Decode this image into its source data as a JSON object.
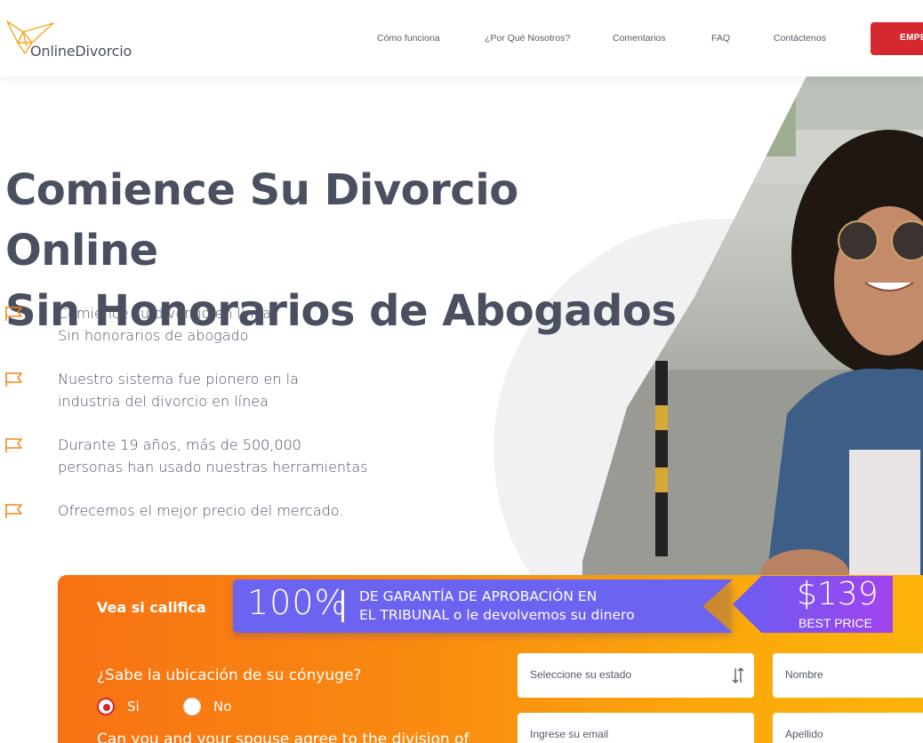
{
  "brand": {
    "name": "OnlineDivorcio"
  },
  "nav": {
    "items": [
      "Cómo funciona",
      "¿Por Qué Nosotros?",
      "Comentarios",
      "FAQ",
      "Contáctenos"
    ],
    "cta_label": "EMPE"
  },
  "hero": {
    "title_line1": "Comience Su Divorcio Online",
    "title_line2": "Sin Honorarios de Abogados",
    "features": [
      "Comience su divorcio en línea\nSin honorarios de abogado",
      "Nuestro sistema fue pionero en la\nindustria del divorcio en línea",
      "Durante 19 años, más de 500,000\npersonas han usado nuestras herramientas",
      "Ofrecemos el mejor precio del mercado."
    ]
  },
  "banner": {
    "big_text": "100%",
    "text": "DE GARANTÍA DE APROBACIÓN EN\nEL TRIBUNAL o le devolvemos su dinero",
    "price": "$139",
    "price_label": "BEST PRICE"
  },
  "form": {
    "title": "Vea si califica",
    "question1": "¿Sabe la ubicación de su cónyuge?",
    "radio_yes": "Si",
    "radio_no": "No",
    "radio_selected": "Si",
    "question2": "Can you and your spouse agree to the division of",
    "state_select": "Seleccione su estado",
    "first_name_placeholder": "Nombre",
    "email_placeholder": "Ingrese su email",
    "last_name_placeholder": "Apellido"
  },
  "colors": {
    "brand_red": "#d42a2f",
    "brand_orange": "#f7851a",
    "ribbon_purple": "#6c63f0",
    "text_dark": "#4b5060"
  }
}
